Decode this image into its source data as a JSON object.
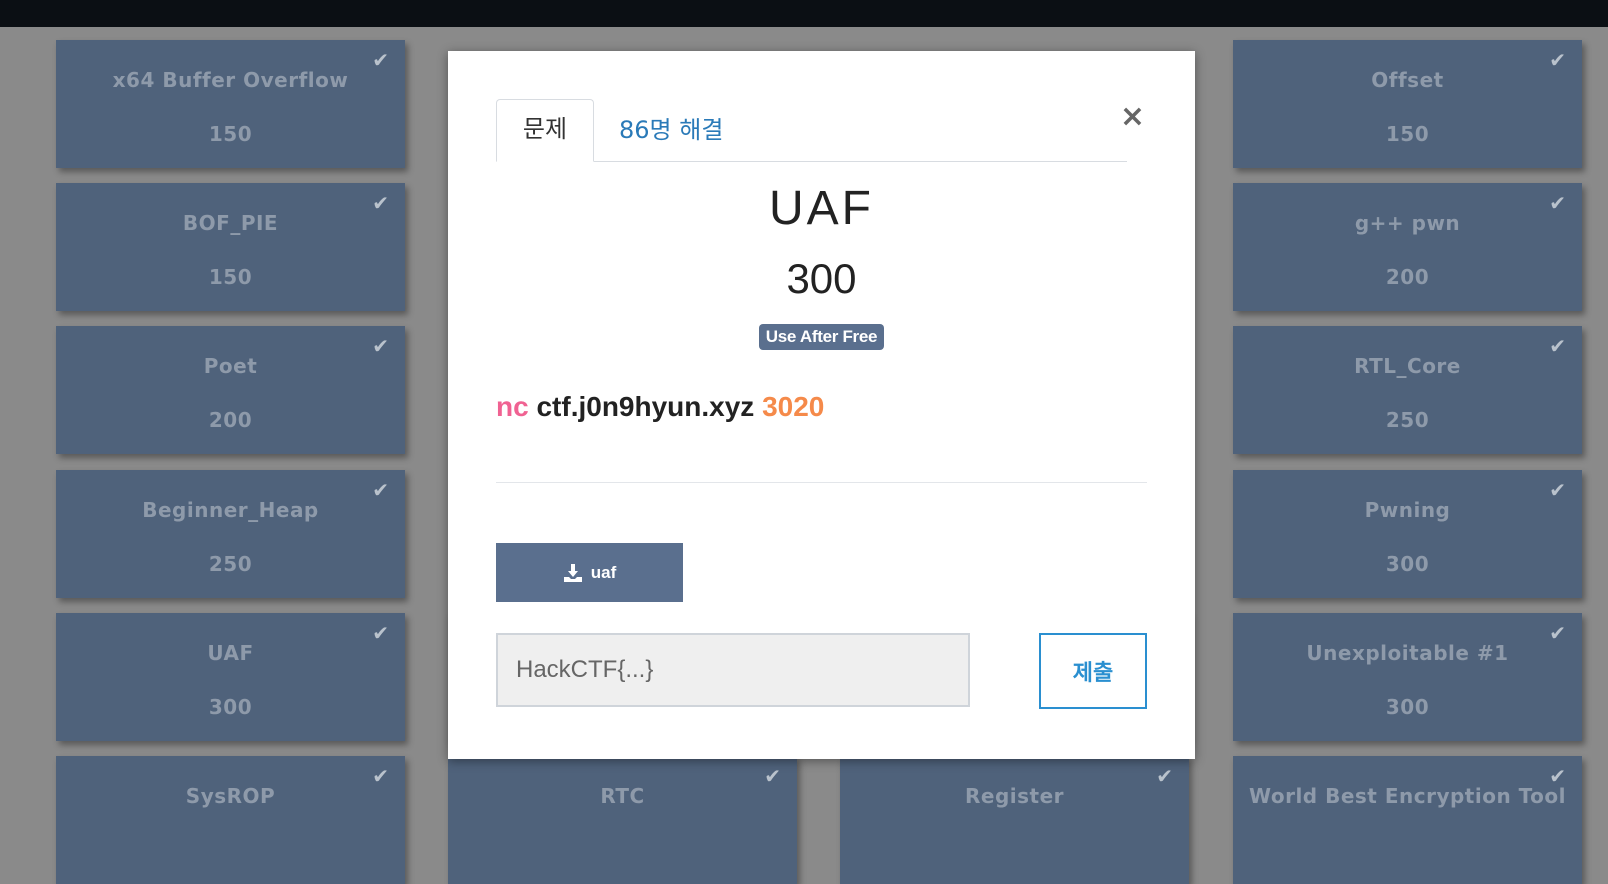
{
  "challenges": [
    {
      "name": "x64 Buffer Overflow",
      "points": "150"
    },
    {
      "name": "BOF_PIE",
      "points": "150"
    },
    {
      "name": "Poet",
      "points": "200"
    },
    {
      "name": "Beginner_Heap",
      "points": "250"
    },
    {
      "name": "UAF",
      "points": "300"
    },
    {
      "name": "SysROP",
      "points": ""
    },
    {
      "name": "RTC",
      "points": ""
    },
    {
      "name": "Register",
      "points": ""
    },
    {
      "name": "Offset",
      "points": "150"
    },
    {
      "name": "g++ pwn",
      "points": "200"
    },
    {
      "name": "RTL_Core",
      "points": "250"
    },
    {
      "name": "Pwning",
      "points": "300"
    },
    {
      "name": "Unexploitable #1",
      "points": "300"
    },
    {
      "name": "World Best Encryption Tool",
      "points": ""
    }
  ],
  "check_icon": "✔",
  "modal": {
    "tab_problem": "문제",
    "tab_solves": "86명 해결",
    "close_icon": "×",
    "title": "UAF",
    "points": "300",
    "tag": "Use After Free",
    "desc_nc": "nc",
    "desc_host": "ctf.j0n9hyun.xyz",
    "desc_port": "3020",
    "download_label": "uaf",
    "flag_placeholder": "HackCTF{...}",
    "submit_label": "제출"
  }
}
